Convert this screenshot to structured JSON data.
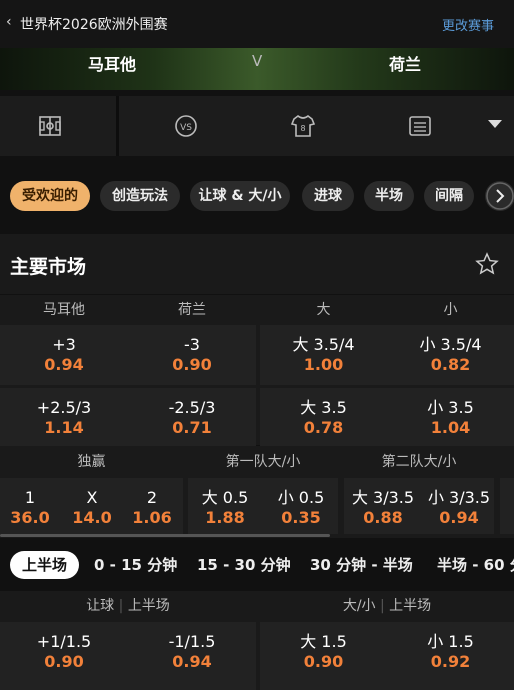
{
  "header": {
    "back_icon": "chevron-left-icon",
    "title": "世界杯2026欧洲外围赛",
    "change_label": "更改赛事"
  },
  "match": {
    "home": "马耳他",
    "vs": "V",
    "away": "荷兰"
  },
  "icon_tabs": [
    "pitch-icon",
    "vs-icon",
    "jersey-icon",
    "scoreboard-icon",
    "dropdown-icon"
  ],
  "chips": [
    "受欢迎的",
    "创造玩法",
    "让球 & 大/小",
    "进球",
    "半场",
    "间隔"
  ],
  "main_market": {
    "title": "主要市场",
    "headers": [
      "马耳他",
      "荷兰",
      "大",
      "小"
    ],
    "rows": [
      [
        {
          "l": "+3",
          "v": "0.94"
        },
        {
          "l": "-3",
          "v": "0.90"
        },
        {
          "l": "大 3.5/4",
          "v": "1.00"
        },
        {
          "l": "小 3.5/4",
          "v": "0.82"
        }
      ],
      [
        {
          "l": "+2.5/3",
          "v": "1.14"
        },
        {
          "l": "-2.5/3",
          "v": "0.71"
        },
        {
          "l": "大 3.5",
          "v": "0.78"
        },
        {
          "l": "小 3.5",
          "v": "1.04"
        }
      ]
    ]
  },
  "secondary": {
    "groups": [
      "独赢",
      "第一队大/小",
      "第二队大/小"
    ],
    "moneyline": [
      {
        "l": "1",
        "v": "36.0"
      },
      {
        "l": "X",
        "v": "14.0"
      },
      {
        "l": "2",
        "v": "1.06"
      }
    ],
    "team1_ou": [
      {
        "l": "大 0.5",
        "v": "1.88"
      },
      {
        "l": "小 0.5",
        "v": "0.35"
      }
    ],
    "team2_ou": [
      {
        "l": "大 3/3.5",
        "v": "0.88"
      },
      {
        "l": "小 3/3.5",
        "v": "0.94"
      }
    ]
  },
  "period_tabs": [
    "上半场",
    "0 - 15 分钟",
    "15 - 30 分钟",
    "30 分钟 - 半场",
    "半场 - 60 分"
  ],
  "half": {
    "hdr_left_a": "让球",
    "hdr_left_b": "上半场",
    "hdr_right_a": "大/小",
    "hdr_right_b": "上半场",
    "row": [
      {
        "l": "+1/1.5",
        "v": "0.90"
      },
      {
        "l": "-1/1.5",
        "v": "0.94"
      },
      {
        "l": "大 1.5",
        "v": "0.90"
      },
      {
        "l": "小 1.5",
        "v": "0.92"
      }
    ]
  },
  "colors": {
    "accent_chip": "#f0b26b",
    "odds": "#f2813a",
    "link": "#5b9bd8"
  }
}
